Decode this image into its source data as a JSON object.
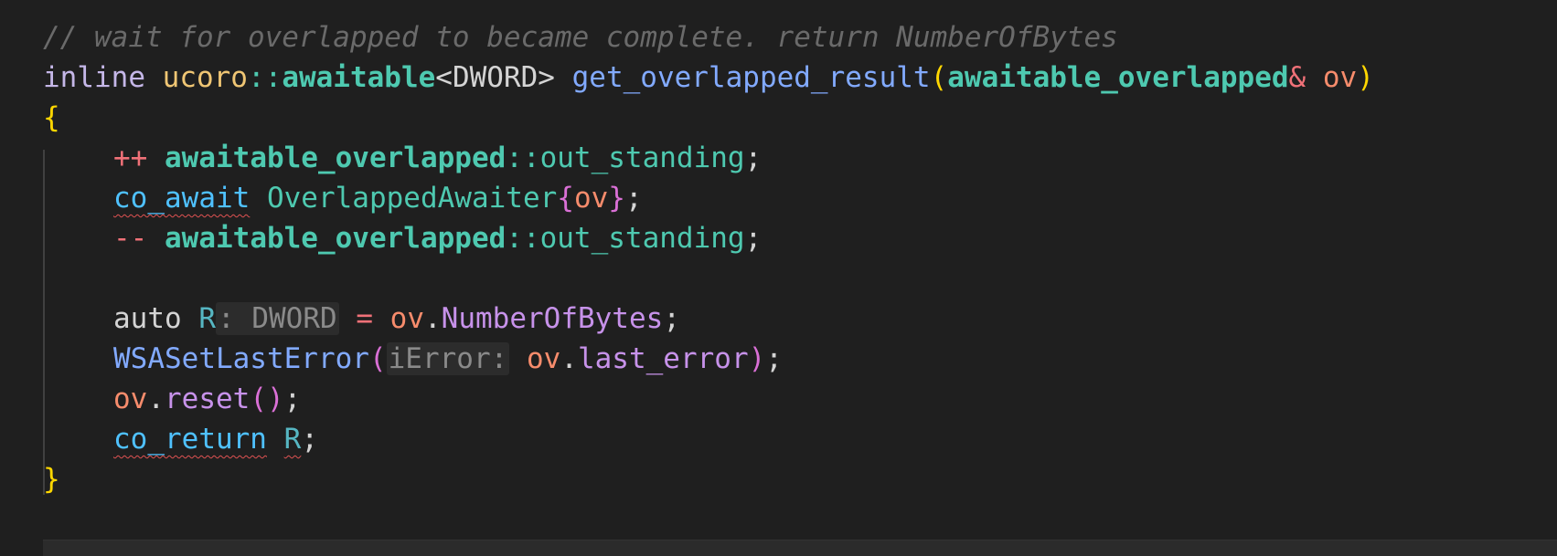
{
  "code": {
    "comment": "// wait for overlapped to became complete. return NumberOfBytes",
    "sig_inline": "inline",
    "sig_ns": "ucoro",
    "sig_scope": "::",
    "sig_awaitable": "awaitable",
    "sig_lt": "<",
    "sig_dword": "DWORD",
    "sig_gt": ">",
    "sig_func": "get_overlapped_result",
    "sig_lparen": "(",
    "sig_param_type": "awaitable_overlapped",
    "sig_amp": "&",
    "sig_param": "ov",
    "sig_rparen": ")",
    "open_brace": "{",
    "l1_op": "++",
    "l1_type": "awaitable_overlapped",
    "l1_scope": "::",
    "l1_member": "out_standing",
    "l1_semi": ";",
    "l2_kw": "co_await",
    "l2_type": "OverlappedAwaiter",
    "l2_lb": "{",
    "l2_arg": "ov",
    "l2_rb": "}",
    "l2_semi": ";",
    "l3_op": "--",
    "l3_type": "awaitable_overlapped",
    "l3_scope": "::",
    "l3_member": "out_standing",
    "l3_semi": ";",
    "l5_auto": "auto",
    "l5_var": "R",
    "l5_hint": ": DWORD",
    "l5_eq": "=",
    "l5_obj": "ov",
    "l5_dot": ".",
    "l5_prop": "NumberOfBytes",
    "l5_semi": ";",
    "l6_func": "WSASetLastError",
    "l6_lp": "(",
    "l6_hint": "iError:",
    "l6_obj": "ov",
    "l6_dot": ".",
    "l6_prop": "last_error",
    "l6_rp": ")",
    "l6_semi": ";",
    "l7_obj": "ov",
    "l7_dot": ".",
    "l7_method": "reset",
    "l7_parens": "()",
    "l7_semi": ";",
    "l8_kw": "co_return",
    "l8_var": "R",
    "l8_semi": ";",
    "close_brace": "}"
  }
}
